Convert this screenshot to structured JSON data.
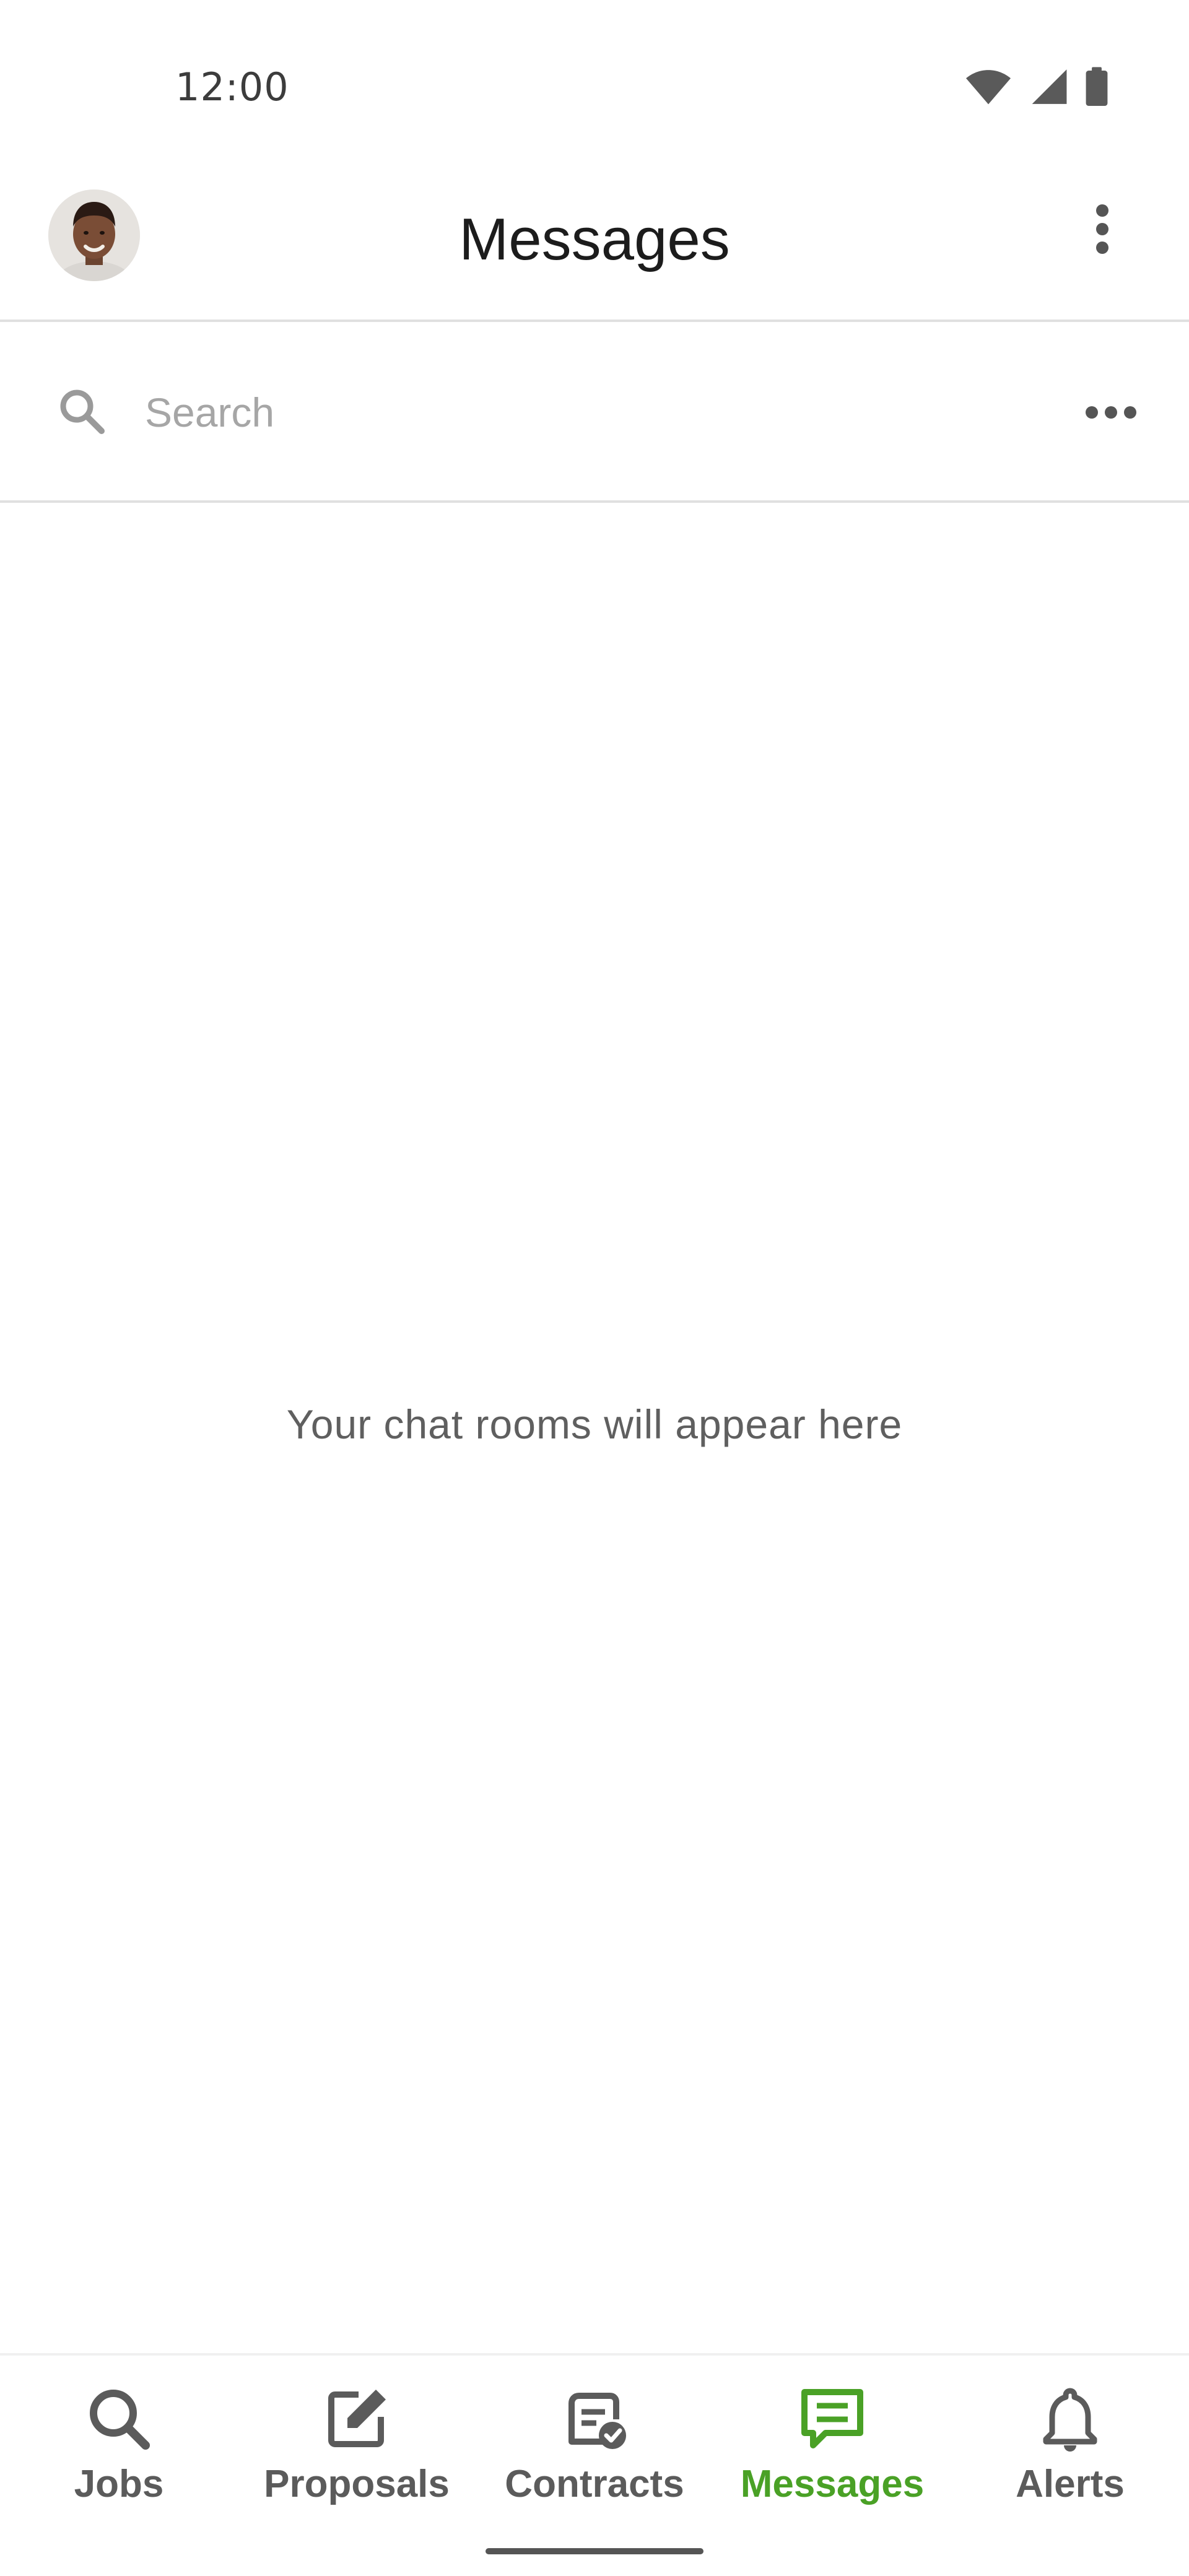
{
  "status_bar": {
    "time": "12:00",
    "icons": [
      "wifi-icon",
      "cell-signal-icon",
      "battery-icon"
    ]
  },
  "app_bar": {
    "title": "Messages",
    "avatar": "avatar",
    "menu_icon": "more-vert-icon"
  },
  "search": {
    "placeholder": "Search",
    "value": "",
    "icon": "search-icon",
    "more_icon": "more-horiz-icon"
  },
  "empty_state": {
    "message": "Your chat rooms will appear here"
  },
  "bottom_nav": {
    "items": [
      {
        "label": "Jobs",
        "icon": "search-icon",
        "active": false
      },
      {
        "label": "Proposals",
        "icon": "edit-note-icon",
        "active": false
      },
      {
        "label": "Contracts",
        "icon": "contract-check-icon",
        "active": false
      },
      {
        "label": "Messages",
        "icon": "chat-icon",
        "active": true
      },
      {
        "label": "Alerts",
        "icon": "bell-icon",
        "active": false
      }
    ]
  },
  "colors": {
    "accent": "#4aa126",
    "nav_inactive": "#5b5b5b",
    "divider": "#e0e0e0",
    "placeholder": "#a6a6a6"
  }
}
